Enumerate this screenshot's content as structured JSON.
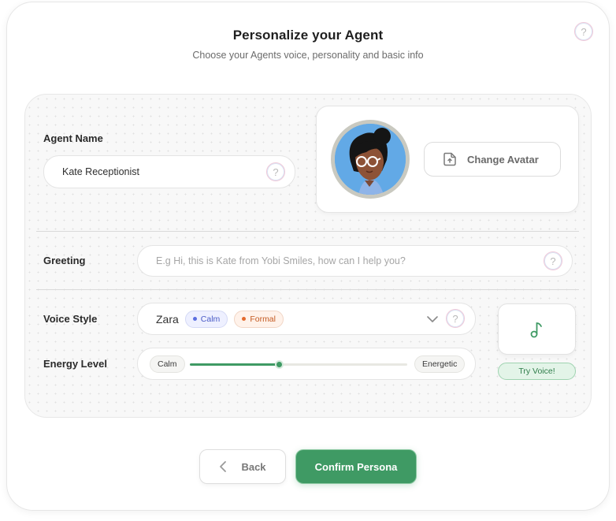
{
  "header": {
    "title": "Personalize your Agent",
    "subtitle": "Choose your Agents voice, personality and basic info"
  },
  "help_glyph": "?",
  "agent_name": {
    "label": "Agent Name",
    "value": "Kate Receptionist"
  },
  "avatar": {
    "change_label": "Change Avatar"
  },
  "greeting": {
    "label": "Greeting",
    "placeholder": "E.g Hi, this is Kate from Yobi Smiles, how can I help you?"
  },
  "voice_style": {
    "label": "Voice Style",
    "selected_voice": "Zara",
    "tags": [
      {
        "label": "Calm",
        "color": "#5b6ee0"
      },
      {
        "label": "Formal",
        "color": "#e46a2c"
      }
    ]
  },
  "energy_level": {
    "label": "Energy Level",
    "min_label": "Calm",
    "max_label": "Energetic",
    "value_fraction": 0.41
  },
  "try_voice_label": "Try Voice!",
  "footer": {
    "back_label": "Back",
    "confirm_label": "Confirm Persona"
  },
  "colors": {
    "accent_green": "#3f9a64",
    "slider_track_fill": "#3f9a64"
  }
}
